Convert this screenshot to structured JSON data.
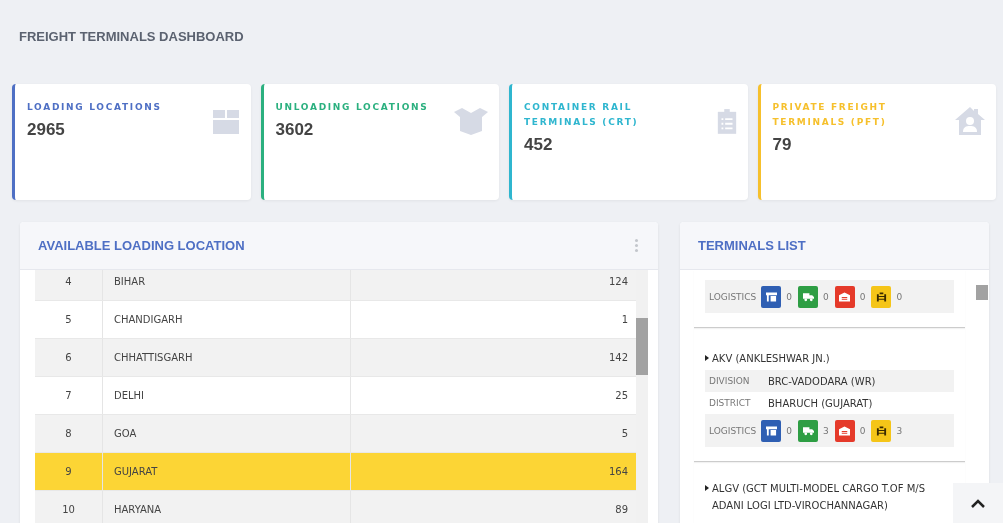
{
  "page_title": "FREIGHT TERMINALS DASHBOARD",
  "stat_cards": [
    {
      "label": "LOADING LOCATIONS",
      "value": "2965",
      "color": "#4e6fc4"
    },
    {
      "label": "UNLOADING LOCATIONS",
      "value": "3602",
      "color": "#2bb07f"
    },
    {
      "label": "CONTAINER RAIL TERMINALS (CRT)",
      "value": "452",
      "color": "#2fb6cf"
    },
    {
      "label": "PRIVATE FREIGHT TERMINALS (PFT)",
      "value": "79",
      "color": "#f6c02c"
    }
  ],
  "loading_panel": {
    "title": "AVAILABLE LOADING LOCATION",
    "rows": [
      {
        "number": "4",
        "state": "BIHAR",
        "count": "124",
        "selected": false
      },
      {
        "number": "5",
        "state": "CHANDIGARH",
        "count": "1",
        "selected": false
      },
      {
        "number": "6",
        "state": "CHHATTISGARH",
        "count": "142",
        "selected": false
      },
      {
        "number": "7",
        "state": "DELHI",
        "count": "25",
        "selected": false
      },
      {
        "number": "8",
        "state": "GOA",
        "count": "5",
        "selected": false
      },
      {
        "number": "9",
        "state": "GUJARAT",
        "count": "164",
        "selected": true
      },
      {
        "number": "10",
        "state": "HARYANA",
        "count": "89",
        "selected": false
      }
    ]
  },
  "terminals_panel": {
    "title": "TERMINALS LIST",
    "entries": [
      {
        "logistics_label": "LOGISTICS",
        "logistics": [
          {
            "color": "#2f5fb3",
            "count": "0"
          },
          {
            "color": "#2e9e44",
            "count": "0"
          },
          {
            "color": "#e53a2a",
            "count": "0"
          },
          {
            "color": "#f5c518",
            "count": "0"
          }
        ]
      },
      {
        "name": "AKV (ANKLESHWAR JN.)",
        "division_label": "DIVISION",
        "division": "BRC-VADODARA (WR)",
        "district_label": "DISTRICT",
        "district": "BHARUCH (GUJARAT)",
        "logistics_label": "LOGISTICS",
        "logistics": [
          {
            "color": "#2f5fb3",
            "count": "0"
          },
          {
            "color": "#2e9e44",
            "count": "3"
          },
          {
            "color": "#e53a2a",
            "count": "0"
          },
          {
            "color": "#f5c518",
            "count": "3"
          }
        ]
      },
      {
        "name": "ALGV (GCT MULTI-MODEL CARGO T.OF M/S ADANI LOGI LTD-VIROCHANNAGAR)"
      }
    ]
  }
}
